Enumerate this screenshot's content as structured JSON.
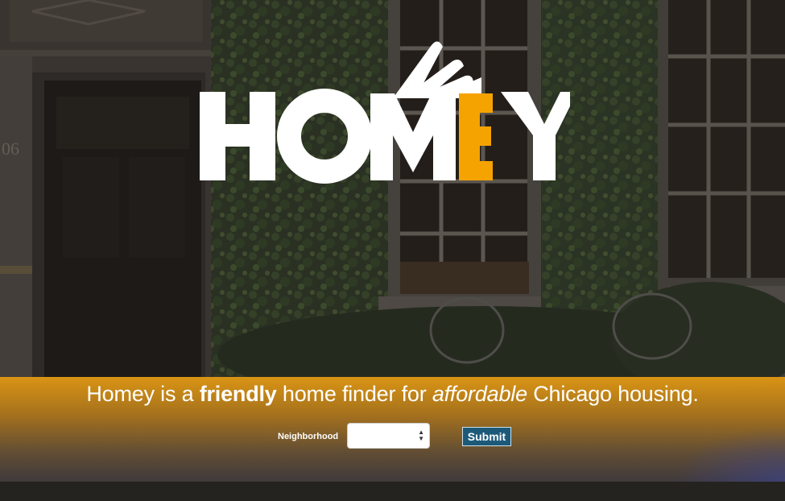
{
  "logo": {
    "letters": [
      "H",
      "O",
      "M",
      "E",
      "Y"
    ],
    "text_color": "#ffffff",
    "accent_color": "#f5a300"
  },
  "tagline": {
    "part1": "Homey is a ",
    "bold": "friendly",
    "part2": " home finder for ",
    "italic": "affordable",
    "part3": " Chicago housing."
  },
  "form": {
    "neighborhood_label": "Neighborhood",
    "neighborhood_value": "",
    "submit_label": "Submit"
  },
  "colors": {
    "band_top": "#e09814",
    "submit_bg": "#1d5a7a"
  },
  "door_number": "06"
}
